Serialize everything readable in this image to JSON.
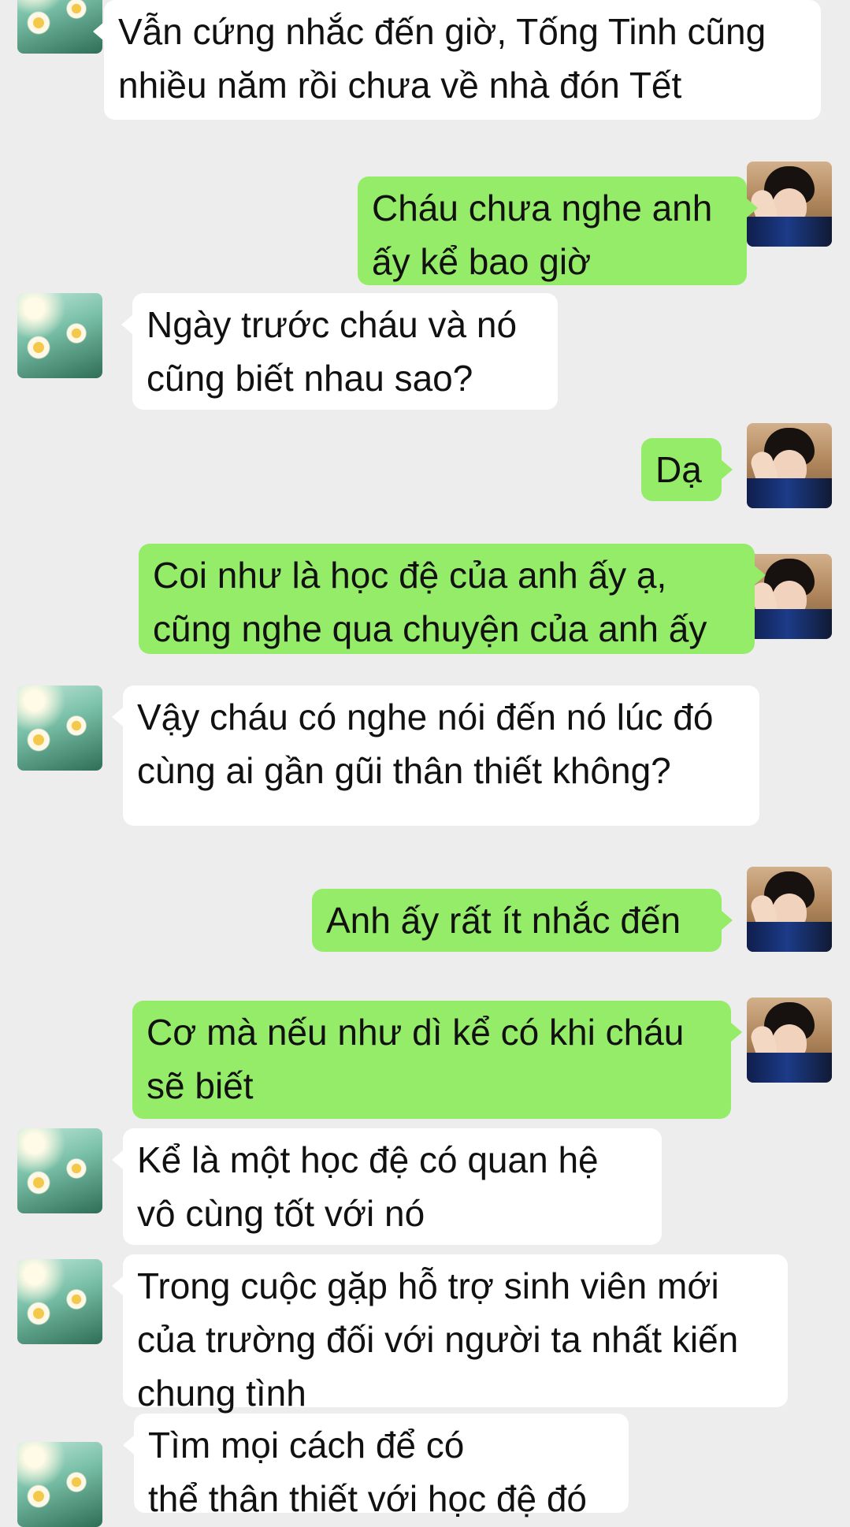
{
  "avatars": {
    "other": "flower-avatar",
    "self": "person-avatar"
  },
  "messages": [
    {
      "side": "in",
      "text": "Vẫn cứng nhắc đến giờ, Tống Tinh cũng\nnhiều năm rồi chưa về nhà đón Tết"
    },
    {
      "side": "out",
      "text": "Cháu chưa nghe anh\nấy kể bao giờ"
    },
    {
      "side": "in",
      "text": "Ngày trước cháu và nó\ncũng biết nhau sao?"
    },
    {
      "side": "out",
      "text": "Dạ"
    },
    {
      "side": "out",
      "text": "Coi như là học đệ của anh ấy ạ,\ncũng nghe qua chuyện của anh ấy"
    },
    {
      "side": "in",
      "text": "Vậy cháu có nghe nói đến nó lúc đó\ncùng ai gần gũi thân thiết không?"
    },
    {
      "side": "out",
      "text": "Anh ấy rất ít nhắc đến"
    },
    {
      "side": "out",
      "text": "Cơ mà nếu như dì kể có khi cháu\nsẽ biết"
    },
    {
      "side": "in",
      "text": "Kể là một học đệ có quan hệ\nvô cùng tốt với nó"
    },
    {
      "side": "in",
      "text": "Trong cuộc gặp hỗ trợ sinh viên mới\ncủa trường đối với người ta nhất kiến\nchung tình"
    },
    {
      "side": "in",
      "text": "Tìm mọi cách để có\nthể thân thiết với học đệ đó"
    }
  ]
}
